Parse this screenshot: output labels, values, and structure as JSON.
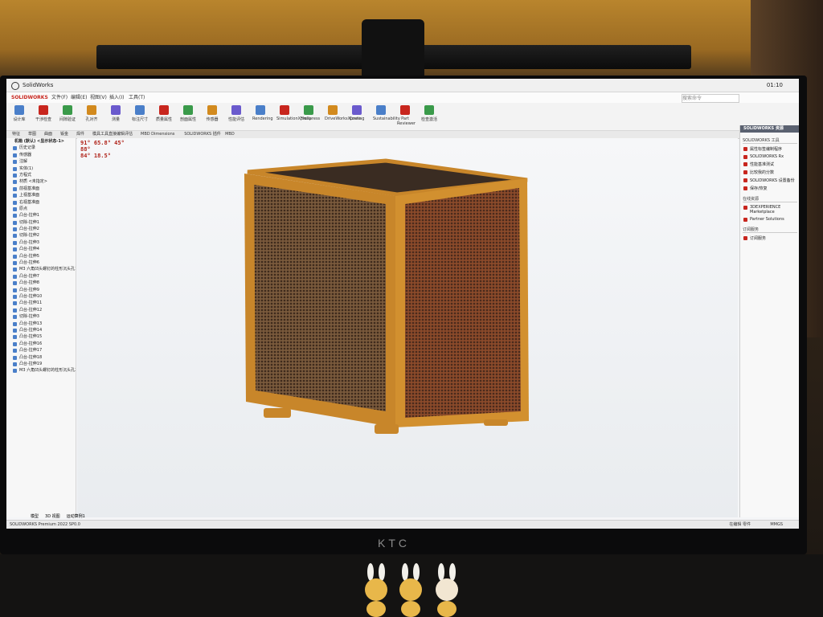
{
  "window": {
    "title": "SolidWorks",
    "clock": "01:10"
  },
  "menu": {
    "brand": "SOLIDWORKS",
    "items": [
      "文件(F)",
      "编辑(E)",
      "视图(V)",
      "插入(I)",
      "工具(T)"
    ]
  },
  "search": {
    "placeholder": "搜索命令"
  },
  "ribbon": {
    "buttons": [
      "设计库",
      "干涉检查",
      "间隙验证",
      "孔对齐",
      "测量",
      "标注尺寸",
      "质量属性",
      "剖面属性",
      "传感器",
      "性能评估",
      "Rendering",
      "SimulationXpress",
      "FloXpress",
      "DriveWorksXpress",
      "Costing",
      "Sustainability",
      "Part Reviewer",
      "检查激活"
    ]
  },
  "command_tabs": [
    "特征",
    "草图",
    "曲面",
    "钣金",
    "焊件",
    "模具工具",
    "直接编辑",
    "评估",
    "MBD Dimensions",
    "SOLIDWORKS 插件",
    "MBD"
  ],
  "annotations": [
    {
      "id": "a1",
      "text": "91°  65.8°   45°"
    },
    {
      "id": "a2",
      "text": "88°"
    },
    {
      "id": "a3",
      "text": "84°  18.5°"
    }
  ],
  "feature_tree": {
    "root": "机箱 (默认) <显示状态-1>",
    "items": [
      "历史记录",
      "传感器",
      "注解",
      "实体(1)",
      "方程式",
      "材质 <未指定>",
      "前视基准面",
      "上视基准面",
      "右视基准面",
      "原点",
      "凸台-拉伸1",
      "切除-拉伸1",
      "凸台-拉伸2",
      "切除-拉伸2",
      "凸台-拉伸3",
      "凸台-拉伸4",
      "凸台-拉伸5",
      "凸台-拉伸6",
      "M3 六角凹头螺钉的柱形沉头孔1",
      "凸台-拉伸7",
      "凸台-拉伸8",
      "凸台-拉伸9",
      "凸台-拉伸10",
      "凸台-拉伸11",
      "凸台-拉伸12",
      "切除-拉伸3",
      "凸台-拉伸13",
      "凸台-拉伸14",
      "凸台-拉伸15",
      "凸台-拉伸16",
      "凸台-拉伸17",
      "凸台-拉伸18",
      "凸台-拉伸19",
      "M3 六角凹头螺钉的柱形沉头孔2"
    ]
  },
  "taskpane": {
    "header": "SOLIDWORKS 资源",
    "sections": [
      {
        "title": "SOLIDWORKS 工具",
        "items": [
          "属性标签编制程序",
          "SOLIDWORKS Rx",
          "性能基准测试",
          "比较我的分数",
          "SOLIDWORKS 设置备份",
          "保存/恢复"
        ]
      },
      {
        "title": "在线资源",
        "items": [
          "3DEXPERIENCE Marketplace",
          "Partner Solutions"
        ]
      },
      {
        "title": "订阅服务",
        "items": [
          "订阅服务"
        ]
      }
    ]
  },
  "bottom_tabs": [
    "模型",
    "3D 视图",
    "运动算例1"
  ],
  "status": {
    "left": "SOLIDWORKS Premium 2022 SP0.0",
    "right": "在编辑 零件",
    "units": "MMGS"
  },
  "monitor_brand": "KTC",
  "colors": {
    "wood": "#c8862a",
    "mesh": "#5a3e2a",
    "accent": "#c8261e"
  }
}
